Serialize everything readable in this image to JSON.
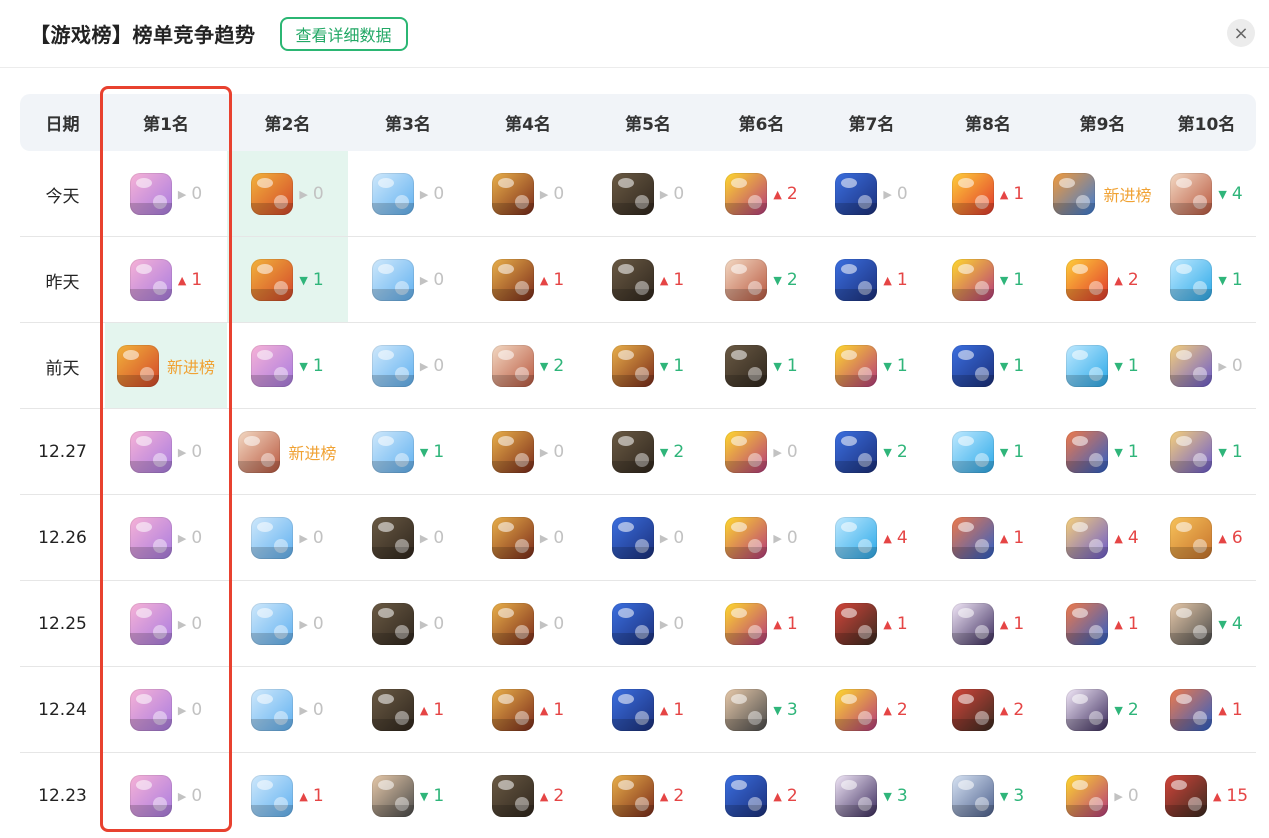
{
  "header": {
    "title": "【游戏榜】榜单竞争趋势",
    "detail_button": "查看详细数据",
    "close_glyph": "×"
  },
  "colors": {
    "accent_green": "#2bb673",
    "up_red": "#e54545",
    "down_green": "#2fb57a",
    "same_gray": "#c2c2c2",
    "new_orange": "#f0a234",
    "highlight_box": "#e8412f"
  },
  "columns": [
    "日期",
    "第1名",
    "第2名",
    "第3名",
    "第4名",
    "第5名",
    "第6名",
    "第7名",
    "第8名",
    "第9名",
    "第10名"
  ],
  "games": {
    "cat": {
      "name": "cat-game-icon",
      "c1": "#f7b2d6",
      "c2": "#a87be0"
    },
    "king": {
      "name": "cookie-king-icon",
      "c1": "#f2b33b",
      "c2": "#d2452a"
    },
    "cloud": {
      "name": "cloud-boy-icon",
      "c1": "#cfe8fb",
      "c2": "#5fb0f0"
    },
    "hero55": {
      "name": "hero-5v5-icon",
      "c1": "#e9b04a",
      "c2": "#7a2a1a"
    },
    "pubg": {
      "name": "battle-royale-icon",
      "c1": "#6a5a44",
      "c2": "#2f261d"
    },
    "chick": {
      "name": "chick-game-icon",
      "c1": "#ffd92e",
      "c2": "#b53a7b"
    },
    "penguin": {
      "name": "penguin-game-icon",
      "c1": "#3b6fe0",
      "c2": "#1b2f7a"
    },
    "koi": {
      "name": "koi-fish-icon",
      "c1": "#ffcf3a",
      "c2": "#e0362c"
    },
    "dragon": {
      "name": "dragon-game-icon",
      "c1": "#f39a3a",
      "c2": "#3a7bd5"
    },
    "girl": {
      "name": "anime-girl-icon",
      "c1": "#f3d9c3",
      "c2": "#b8573f"
    },
    "blob": {
      "name": "blue-blob-icon",
      "c1": "#bfe9ff",
      "c2": "#2aa8e8"
    },
    "squad": {
      "name": "squad-game-icon",
      "c1": "#f6d07a",
      "c2": "#6a5acd"
    },
    "runner": {
      "name": "subway-runner-icon",
      "c1": "#f07a4a",
      "c2": "#2d5fc7"
    },
    "bear": {
      "name": "bear-game-icon",
      "c1": "#f7c25a",
      "c2": "#c6722c"
    },
    "soldier": {
      "name": "soldier-game-icon",
      "c1": "#e7c9a9",
      "c2": "#4a4a4a"
    },
    "warrior": {
      "name": "warrior-game-icon",
      "c1": "#d3453a",
      "c2": "#3a2a20"
    },
    "ninja": {
      "name": "ninja-game-icon",
      "c1": "#f2e8f8",
      "c2": "#3b2b5c"
    },
    "knight": {
      "name": "knight-game-icon",
      "c1": "#d8e4f4",
      "c2": "#4c5f8c"
    }
  },
  "rows": [
    {
      "date": "今天",
      "cells": [
        {
          "g": "cat",
          "d": "same",
          "v": "0"
        },
        {
          "g": "king",
          "d": "same",
          "v": "0"
        },
        {
          "g": "cloud",
          "d": "same",
          "v": "0"
        },
        {
          "g": "hero55",
          "d": "same",
          "v": "0"
        },
        {
          "g": "pubg",
          "d": "same",
          "v": "0"
        },
        {
          "g": "chick",
          "d": "up",
          "v": "2"
        },
        {
          "g": "penguin",
          "d": "same",
          "v": "0"
        },
        {
          "g": "koi",
          "d": "up",
          "v": "1"
        },
        {
          "g": "dragon",
          "d": "new",
          "v": "新进榜"
        },
        {
          "g": "girl",
          "d": "down",
          "v": "4"
        }
      ]
    },
    {
      "date": "昨天",
      "cells": [
        {
          "g": "cat",
          "d": "up",
          "v": "1"
        },
        {
          "g": "king",
          "d": "down",
          "v": "1"
        },
        {
          "g": "cloud",
          "d": "same",
          "v": "0"
        },
        {
          "g": "hero55",
          "d": "up",
          "v": "1"
        },
        {
          "g": "pubg",
          "d": "up",
          "v": "1"
        },
        {
          "g": "girl",
          "d": "down",
          "v": "2"
        },
        {
          "g": "penguin",
          "d": "up",
          "v": "1"
        },
        {
          "g": "chick",
          "d": "down",
          "v": "1"
        },
        {
          "g": "koi",
          "d": "up",
          "v": "2"
        },
        {
          "g": "blob",
          "d": "down",
          "v": "1"
        }
      ]
    },
    {
      "date": "前天",
      "cells": [
        {
          "g": "king",
          "d": "new",
          "v": "新进榜"
        },
        {
          "g": "cat",
          "d": "down",
          "v": "1"
        },
        {
          "g": "cloud",
          "d": "same",
          "v": "0"
        },
        {
          "g": "girl",
          "d": "down",
          "v": "2"
        },
        {
          "g": "hero55",
          "d": "down",
          "v": "1"
        },
        {
          "g": "pubg",
          "d": "down",
          "v": "1"
        },
        {
          "g": "chick",
          "d": "down",
          "v": "1"
        },
        {
          "g": "penguin",
          "d": "down",
          "v": "1"
        },
        {
          "g": "blob",
          "d": "down",
          "v": "1"
        },
        {
          "g": "squad",
          "d": "same",
          "v": "0"
        }
      ]
    },
    {
      "date": "12.27",
      "cells": [
        {
          "g": "cat",
          "d": "same",
          "v": "0"
        },
        {
          "g": "girl",
          "d": "new",
          "v": "新进榜"
        },
        {
          "g": "cloud",
          "d": "down",
          "v": "1"
        },
        {
          "g": "hero55",
          "d": "same",
          "v": "0"
        },
        {
          "g": "pubg",
          "d": "down",
          "v": "2"
        },
        {
          "g": "chick",
          "d": "same",
          "v": "0"
        },
        {
          "g": "penguin",
          "d": "down",
          "v": "2"
        },
        {
          "g": "blob",
          "d": "down",
          "v": "1"
        },
        {
          "g": "runner",
          "d": "down",
          "v": "1"
        },
        {
          "g": "squad",
          "d": "down",
          "v": "1"
        }
      ]
    },
    {
      "date": "12.26",
      "cells": [
        {
          "g": "cat",
          "d": "same",
          "v": "0"
        },
        {
          "g": "cloud",
          "d": "same",
          "v": "0"
        },
        {
          "g": "pubg",
          "d": "same",
          "v": "0"
        },
        {
          "g": "hero55",
          "d": "same",
          "v": "0"
        },
        {
          "g": "penguin",
          "d": "same",
          "v": "0"
        },
        {
          "g": "chick",
          "d": "same",
          "v": "0"
        },
        {
          "g": "blob",
          "d": "up",
          "v": "4"
        },
        {
          "g": "runner",
          "d": "up",
          "v": "1"
        },
        {
          "g": "squad",
          "d": "up",
          "v": "4"
        },
        {
          "g": "bear",
          "d": "up",
          "v": "6"
        }
      ]
    },
    {
      "date": "12.25",
      "cells": [
        {
          "g": "cat",
          "d": "same",
          "v": "0"
        },
        {
          "g": "cloud",
          "d": "same",
          "v": "0"
        },
        {
          "g": "pubg",
          "d": "same",
          "v": "0"
        },
        {
          "g": "hero55",
          "d": "same",
          "v": "0"
        },
        {
          "g": "penguin",
          "d": "same",
          "v": "0"
        },
        {
          "g": "chick",
          "d": "up",
          "v": "1"
        },
        {
          "g": "warrior",
          "d": "up",
          "v": "1"
        },
        {
          "g": "ninja",
          "d": "up",
          "v": "1"
        },
        {
          "g": "runner",
          "d": "up",
          "v": "1"
        },
        {
          "g": "soldier",
          "d": "down",
          "v": "4"
        }
      ]
    },
    {
      "date": "12.24",
      "cells": [
        {
          "g": "cat",
          "d": "same",
          "v": "0"
        },
        {
          "g": "cloud",
          "d": "same",
          "v": "0"
        },
        {
          "g": "pubg",
          "d": "up",
          "v": "1"
        },
        {
          "g": "hero55",
          "d": "up",
          "v": "1"
        },
        {
          "g": "penguin",
          "d": "up",
          "v": "1"
        },
        {
          "g": "soldier",
          "d": "down",
          "v": "3"
        },
        {
          "g": "chick",
          "d": "up",
          "v": "2"
        },
        {
          "g": "warrior",
          "d": "up",
          "v": "2"
        },
        {
          "g": "ninja",
          "d": "down",
          "v": "2"
        },
        {
          "g": "runner",
          "d": "up",
          "v": "1"
        }
      ]
    },
    {
      "date": "12.23",
      "cells": [
        {
          "g": "cat",
          "d": "same",
          "v": "0"
        },
        {
          "g": "cloud",
          "d": "up",
          "v": "1"
        },
        {
          "g": "soldier",
          "d": "down",
          "v": "1"
        },
        {
          "g": "pubg",
          "d": "up",
          "v": "2"
        },
        {
          "g": "hero55",
          "d": "up",
          "v": "2"
        },
        {
          "g": "penguin",
          "d": "up",
          "v": "2"
        },
        {
          "g": "ninja",
          "d": "down",
          "v": "3"
        },
        {
          "g": "knight",
          "d": "down",
          "v": "3"
        },
        {
          "g": "chick",
          "d": "same",
          "v": "0"
        },
        {
          "g": "warrior",
          "d": "up",
          "v": "15"
        }
      ]
    }
  ],
  "highlights": [
    {
      "row": 0,
      "col": 2
    },
    {
      "row": 1,
      "col": 2
    },
    {
      "row": 2,
      "col": 1
    }
  ],
  "arrows": {
    "up": "▲",
    "down": "▼",
    "same": "▶"
  }
}
